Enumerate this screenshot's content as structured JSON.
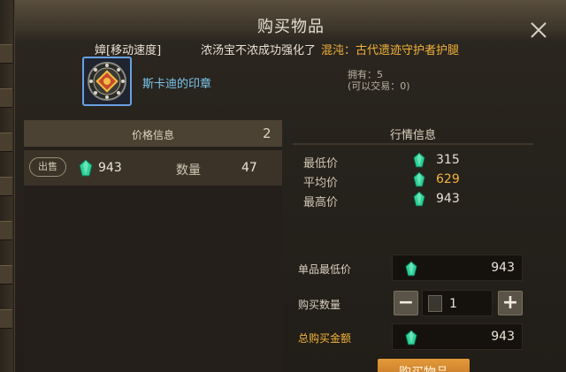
{
  "window": {
    "title": "购买物品",
    "close_icon": "close-icon"
  },
  "marquee": {
    "part1": "嫜[移动速度]",
    "part2": "浓汤宝不浓成功强化了",
    "part3": "混沌：古代遗迹守护者护腿",
    "highlight_color": "#f4b43a"
  },
  "item": {
    "icon": "seal-emblem-icon",
    "name": "斯卡迪的印章",
    "owned": "拥有：5",
    "tradable": "(可以交易：0)",
    "name_color": "#7cc7ef"
  },
  "price_info": {
    "title": "价格信息",
    "count": "2",
    "listings": [
      {
        "badge": "出售",
        "price": "943",
        "qty_label": "数量",
        "qty": "47"
      }
    ]
  },
  "market": {
    "title": "行情信息",
    "rows": [
      {
        "label": "最低价",
        "value": "315"
      },
      {
        "label": "平均价",
        "value": "629",
        "highlight": true
      },
      {
        "label": "最高价",
        "value": "943"
      }
    ]
  },
  "buy": {
    "unit_price_label": "单品最低价",
    "unit_price": "943",
    "qty_label": "购买数量",
    "qty": "1",
    "minus": "−",
    "plus": "+",
    "total_label": "总购买金额",
    "total": "943",
    "button_label": "购买物品"
  },
  "colors": {
    "gem": "#2fd19a",
    "accent_gold": "#f4b43a",
    "button": "#d08a30"
  }
}
